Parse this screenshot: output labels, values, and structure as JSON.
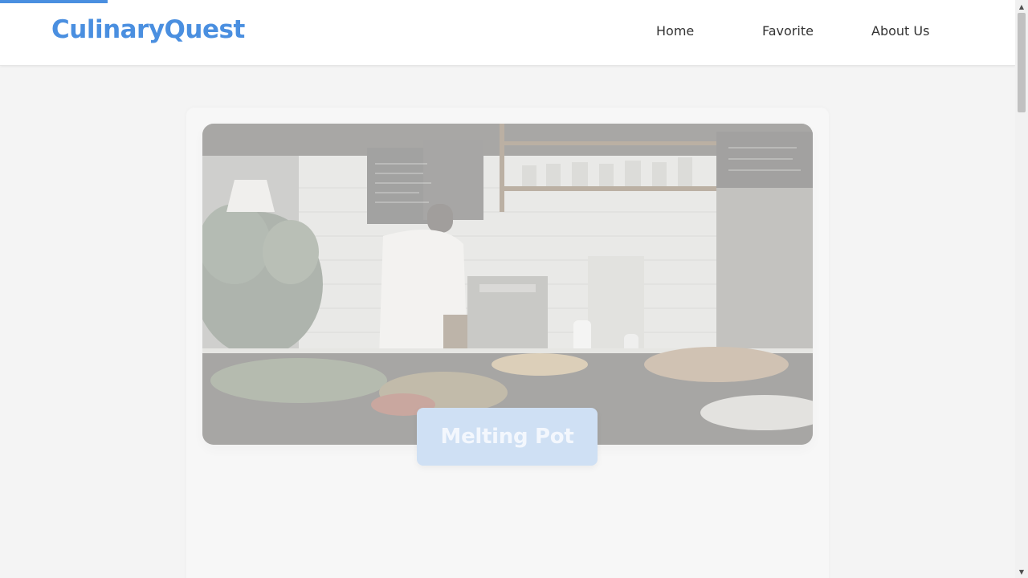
{
  "page_load_progress": 0.105,
  "brand": {
    "name": "CulinaryQuest",
    "color": "#4a8fe0"
  },
  "nav": {
    "items": [
      {
        "label": "Home"
      },
      {
        "label": "Favorite"
      },
      {
        "label": "About Us"
      }
    ]
  },
  "hero": {
    "image_subject": "cafe-interior-with-barista",
    "caption": "Melting Pot"
  },
  "scrollbar": {
    "up_arrow": "▲",
    "down_arrow": "▼"
  }
}
